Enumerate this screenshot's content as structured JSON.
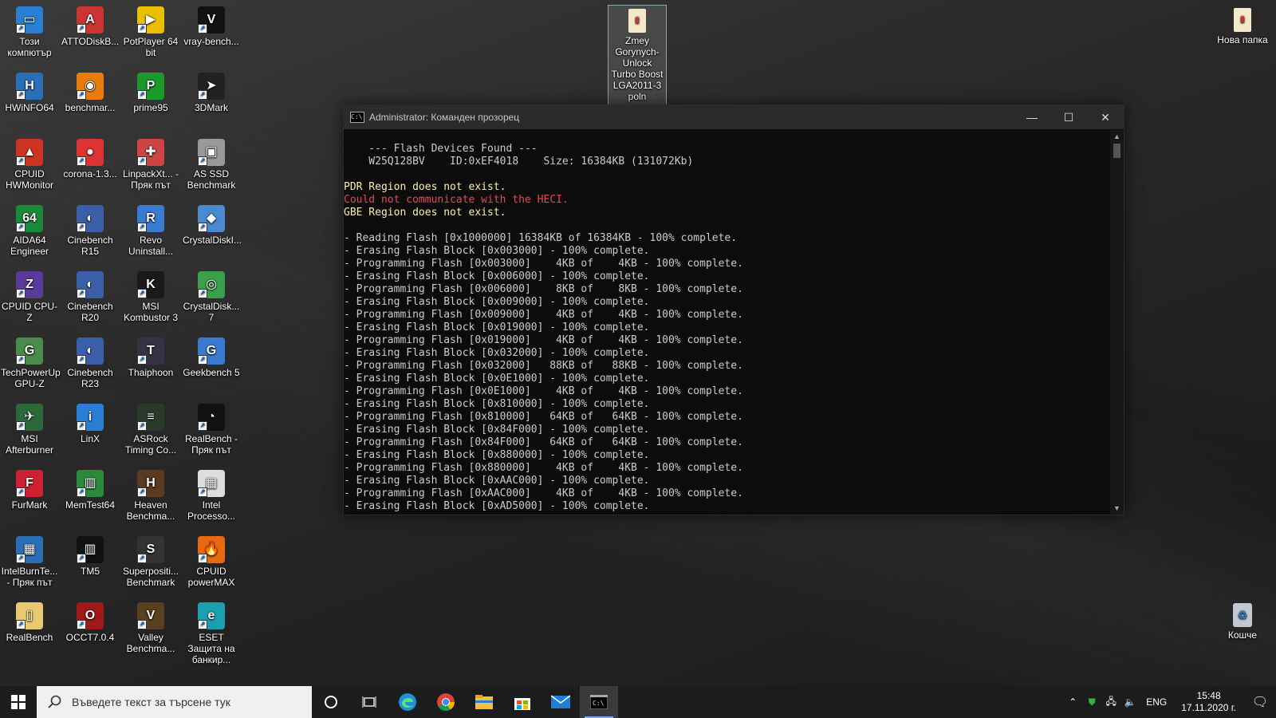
{
  "desktop_icons": [
    {
      "label": "Този компютър",
      "icon": "computer-icon",
      "color": "#2a7fd4",
      "glyph": "▭"
    },
    {
      "label": "ATTODiskB...",
      "icon": "atto-icon",
      "color": "#c33",
      "glyph": "A"
    },
    {
      "label": "PotPlayer 64 bit",
      "icon": "potplayer-icon",
      "color": "#e8c000",
      "glyph": "▶"
    },
    {
      "label": "vray-bench...",
      "icon": "vray-icon",
      "color": "#111",
      "glyph": "V"
    },
    {
      "label": "HWiNFO64",
      "icon": "hwinfo-icon",
      "color": "#2a6fb5",
      "glyph": "H"
    },
    {
      "label": "benchmar...",
      "icon": "blender-icon",
      "color": "#e87d0d",
      "glyph": "◉"
    },
    {
      "label": "prime95",
      "icon": "prime95-icon",
      "color": "#1a9a2a",
      "glyph": "P"
    },
    {
      "label": "3DMark",
      "icon": "3dmark-icon",
      "color": "#222",
      "glyph": "➤"
    },
    {
      "label": "CPUID HWMonitor",
      "icon": "hwmonitor-icon",
      "color": "#c32",
      "glyph": "▲"
    },
    {
      "label": "corona-1.3...",
      "icon": "corona-icon",
      "color": "#d33",
      "glyph": "●"
    },
    {
      "label": "LinpackXt... - Пряк път",
      "icon": "linpack-icon",
      "color": "#c44",
      "glyph": "✚"
    },
    {
      "label": "AS SSD Benchmark",
      "icon": "asssd-icon",
      "color": "#999",
      "glyph": "▣"
    },
    {
      "label": "AIDA64 Engineer",
      "icon": "aida64-icon",
      "color": "#1a8a3a",
      "glyph": "64"
    },
    {
      "label": "Cinebench R15",
      "icon": "cinebench-r15-icon",
      "color": "#3a5fa8",
      "glyph": "◐"
    },
    {
      "label": "Revo Uninstall...",
      "icon": "revo-icon",
      "color": "#3a7ad0",
      "glyph": "R"
    },
    {
      "label": "CrystalDiskI...",
      "icon": "crystaldiskinfo-icon",
      "color": "#4a8ad0",
      "glyph": "◆"
    },
    {
      "label": "CPUID CPU-Z",
      "icon": "cpuz-icon",
      "color": "#5a3a9a",
      "glyph": "Z"
    },
    {
      "label": "Cinebench R20",
      "icon": "cinebench-r20-icon",
      "color": "#3a5fa8",
      "glyph": "◐"
    },
    {
      "label": "MSI Kombustor 3",
      "icon": "kombustor-icon",
      "color": "#1a1a1a",
      "glyph": "K"
    },
    {
      "label": "CrystalDisk... 7",
      "icon": "crystaldiskmark-icon",
      "color": "#3aa04a",
      "glyph": "◎"
    },
    {
      "label": "TechPowerUp GPU-Z",
      "icon": "gpuz-icon",
      "color": "#4a8a4a",
      "glyph": "G"
    },
    {
      "label": "Cinebench R23",
      "icon": "cinebench-r23-icon",
      "color": "#3a5fa8",
      "glyph": "◐"
    },
    {
      "label": "Thaiphoon",
      "icon": "thaiphoon-icon",
      "color": "#334",
      "glyph": "T"
    },
    {
      "label": "Geekbench 5",
      "icon": "geekbench-icon",
      "color": "#3a7ad0",
      "glyph": "G"
    },
    {
      "label": "MSI Afterburner",
      "icon": "afterburner-icon",
      "color": "#2a6a3a",
      "glyph": "✈"
    },
    {
      "label": "LinX",
      "icon": "linx-icon",
      "color": "#2a7fd4",
      "glyph": "i"
    },
    {
      "label": "ASRock Timing Co...",
      "icon": "asrock-icon",
      "color": "#2a3a2a",
      "glyph": "≡"
    },
    {
      "label": "RealBench - Пряк път",
      "icon": "realbench-shortcut-icon",
      "color": "#111",
      "glyph": "◔"
    },
    {
      "label": "FurMark",
      "icon": "furmark-icon",
      "color": "#c23",
      "glyph": "F"
    },
    {
      "label": "MemTest64",
      "icon": "memtest-icon",
      "color": "#2a8a3a",
      "glyph": "▥"
    },
    {
      "label": "Heaven Benchma...",
      "icon": "heaven-icon",
      "color": "#5a3a20",
      "glyph": "H"
    },
    {
      "label": "Intel Processo...",
      "icon": "intel-proc-icon",
      "color": "#ddd",
      "glyph": "▦"
    },
    {
      "label": "IntelBurnTe... - Пряк път",
      "icon": "intelburntest-icon",
      "color": "#2a6fb5",
      "glyph": "▦"
    },
    {
      "label": "TM5",
      "icon": "tm5-icon",
      "color": "#111",
      "glyph": "▥"
    },
    {
      "label": "Superpositi... Benchmark",
      "icon": "superposition-icon",
      "color": "#333",
      "glyph": "S"
    },
    {
      "label": "CPUID powerMAX",
      "icon": "powermax-icon",
      "color": "#e86a10",
      "glyph": "🔥"
    },
    {
      "label": "RealBench",
      "icon": "realbench-folder-icon",
      "color": "#e8c870",
      "glyph": "▯"
    },
    {
      "label": "OCCT7.0.4",
      "icon": "occt-icon",
      "color": "#a01818",
      "glyph": "O"
    },
    {
      "label": "Valley Benchma...",
      "icon": "valley-icon",
      "color": "#5a4020",
      "glyph": "V"
    },
    {
      "label": "ESET Защита на банкир...",
      "icon": "eset-icon",
      "color": "#1aa0b0",
      "glyph": "e"
    }
  ],
  "extra_icons": {
    "zmey": {
      "label": "Zmey Gorynych-Unlock Turbo Boost LGA2011-3 poln",
      "icon": "archive-icon"
    },
    "new_folder": {
      "label": "Нова папка",
      "icon": "folder-icon"
    },
    "recycle": {
      "label": "Кошче",
      "icon": "recycle-bin-icon"
    }
  },
  "window": {
    "title": "Administrator: Команден прозорец",
    "minimize": "—",
    "maximize": "☐",
    "close": "✕"
  },
  "console_lines": [
    {
      "text": "",
      "cls": ""
    },
    {
      "text": "    --- Flash Devices Found ---",
      "cls": ""
    },
    {
      "text": "    W25Q128BV    ID:0xEF4018    Size: 16384KB (131072Kb)",
      "cls": ""
    },
    {
      "text": "",
      "cls": ""
    },
    {
      "text": "PDR Region does not exist.",
      "cls": "yellow"
    },
    {
      "text": "Could not communicate with the HECI.",
      "cls": "red"
    },
    {
      "text": "GBE Region does not exist.",
      "cls": "yellow"
    },
    {
      "text": "",
      "cls": ""
    },
    {
      "text": "- Reading Flash [0x1000000] 16384KB of 16384KB - 100% complete.",
      "cls": ""
    },
    {
      "text": "- Erasing Flash Block [0x003000] - 100% complete.",
      "cls": ""
    },
    {
      "text": "- Programming Flash [0x003000]    4KB of    4KB - 100% complete.",
      "cls": ""
    },
    {
      "text": "- Erasing Flash Block [0x006000] - 100% complete.",
      "cls": ""
    },
    {
      "text": "- Programming Flash [0x006000]    8KB of    8KB - 100% complete.",
      "cls": ""
    },
    {
      "text": "- Erasing Flash Block [0x009000] - 100% complete.",
      "cls": ""
    },
    {
      "text": "- Programming Flash [0x009000]    4KB of    4KB - 100% complete.",
      "cls": ""
    },
    {
      "text": "- Erasing Flash Block [0x019000] - 100% complete.",
      "cls": ""
    },
    {
      "text": "- Programming Flash [0x019000]    4KB of    4KB - 100% complete.",
      "cls": ""
    },
    {
      "text": "- Erasing Flash Block [0x032000] - 100% complete.",
      "cls": ""
    },
    {
      "text": "- Programming Flash [0x032000]   88KB of   88KB - 100% complete.",
      "cls": ""
    },
    {
      "text": "- Erasing Flash Block [0x0E1000] - 100% complete.",
      "cls": ""
    },
    {
      "text": "- Programming Flash [0x0E1000]    4KB of    4KB - 100% complete.",
      "cls": ""
    },
    {
      "text": "- Erasing Flash Block [0x810000] - 100% complete.",
      "cls": ""
    },
    {
      "text": "- Programming Flash [0x810000]   64KB of   64KB - 100% complete.",
      "cls": ""
    },
    {
      "text": "- Erasing Flash Block [0x84F000] - 100% complete.",
      "cls": ""
    },
    {
      "text": "- Programming Flash [0x84F000]   64KB of   64KB - 100% complete.",
      "cls": ""
    },
    {
      "text": "- Erasing Flash Block [0x880000] - 100% complete.",
      "cls": ""
    },
    {
      "text": "- Programming Flash [0x880000]    4KB of    4KB - 100% complete.",
      "cls": ""
    },
    {
      "text": "- Erasing Flash Block [0xAAC000] - 100% complete.",
      "cls": ""
    },
    {
      "text": "- Programming Flash [0xAAC000]    4KB of    4KB - 100% complete.",
      "cls": ""
    },
    {
      "text": "- Erasing Flash Block [0xAD5000] - 100% complete.",
      "cls": ""
    }
  ],
  "taskbar": {
    "search_placeholder": "Въведете текст за търсене тук",
    "language": "ENG",
    "time": "15:48",
    "date": "17.11.2020 г."
  },
  "colors": {
    "console_bg": "#0c0c0c",
    "console_text": "#cccccc",
    "warning_yellow": "#f9f1a5",
    "error_red": "#e74856",
    "taskbar_bg": "#1c1c1c"
  }
}
